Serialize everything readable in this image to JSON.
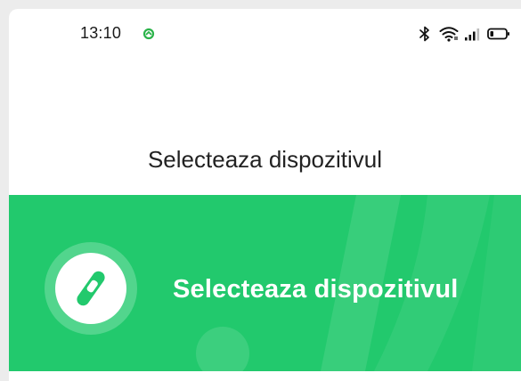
{
  "status_bar": {
    "time": "13:10"
  },
  "page": {
    "title": "Selecteaza dispozitivul"
  },
  "device_card": {
    "label": "Selecteaza dispozitivul",
    "icon": "fitness-band-icon"
  },
  "colors": {
    "accent": "#22c96d",
    "text": "#222222",
    "background": "#ffffff"
  }
}
